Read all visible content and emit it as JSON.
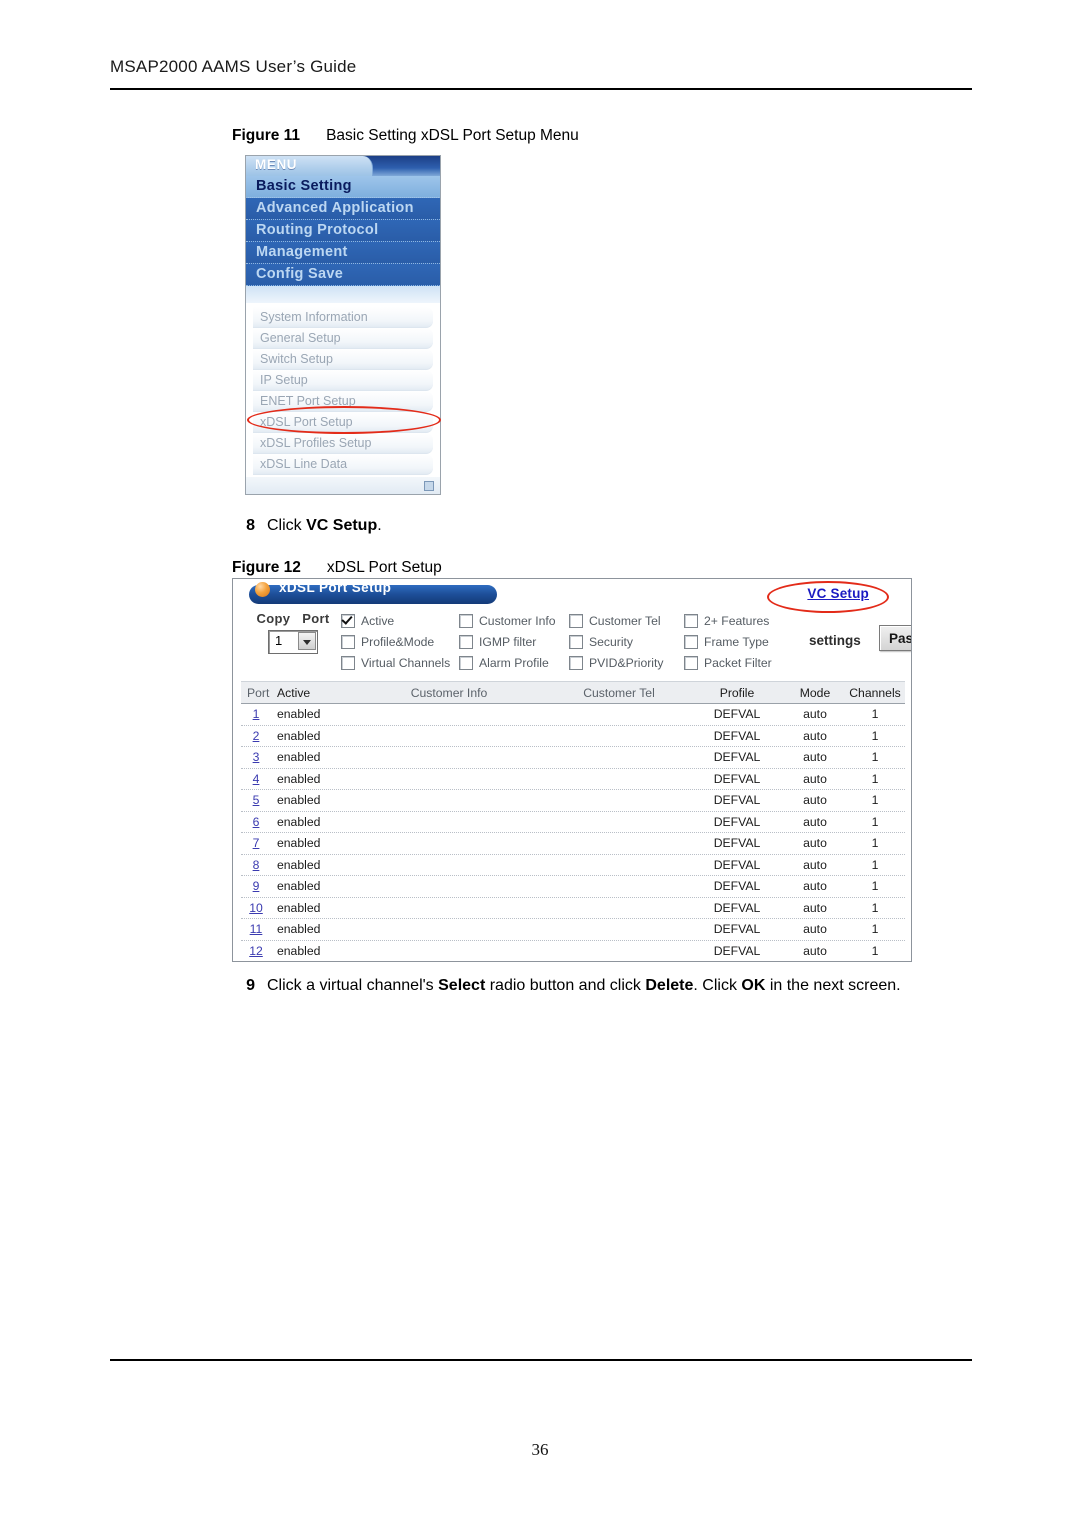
{
  "page": {
    "header_title": "MSAP2000 AAMS User’s Guide",
    "page_number": "36"
  },
  "figure11": {
    "label": "Figure 11",
    "title": "Basic Setting xDSL Port Setup Menu",
    "menu": {
      "tab_label": "MENU",
      "main_items": [
        {
          "label": "Basic Setting",
          "selected": true
        },
        {
          "label": "Advanced Application",
          "selected": false
        },
        {
          "label": "Routing Protocol",
          "selected": false
        },
        {
          "label": "Management",
          "selected": false
        },
        {
          "label": "Config Save",
          "selected": false
        }
      ],
      "sub_items": [
        {
          "label": "System Information",
          "highlighted": false
        },
        {
          "label": "General Setup",
          "highlighted": false
        },
        {
          "label": "Switch Setup",
          "highlighted": false
        },
        {
          "label": "IP Setup",
          "highlighted": false
        },
        {
          "label": "ENET Port Setup",
          "highlighted": false
        },
        {
          "label": "xDSL Port Setup",
          "highlighted": true
        },
        {
          "label": "xDSL Profiles Setup",
          "highlighted": false
        },
        {
          "label": "xDSL Line Data",
          "highlighted": false
        }
      ],
      "highlight_color": "#e32b19"
    }
  },
  "step8": {
    "number": "8",
    "text_before": "Click ",
    "bold": "VC Setup",
    "text_after": "."
  },
  "figure12": {
    "label": "Figure 12",
    "title": "xDSL Port Setup",
    "screen": {
      "panel_title": "xDSL Port Setup",
      "vc_setup_link": "VC Setup",
      "copy_label": "Copy",
      "port_label": "Port",
      "port_select_value": "1",
      "settings_label": "settings",
      "paste_button": "Paste",
      "checkboxes": [
        {
          "label": "Active",
          "checked": true
        },
        {
          "label": "Customer Info",
          "checked": false
        },
        {
          "label": "Customer Tel",
          "checked": false
        },
        {
          "label": "2+ Features",
          "checked": false
        },
        {
          "label": "Profile&Mode",
          "checked": false
        },
        {
          "label": "IGMP filter",
          "checked": false
        },
        {
          "label": "Security",
          "checked": false
        },
        {
          "label": "Frame Type",
          "checked": false
        },
        {
          "label": "Virtual Channels",
          "checked": false
        },
        {
          "label": "Alarm Profile",
          "checked": false
        },
        {
          "label": "PVID&Priority",
          "checked": false
        },
        {
          "label": "Packet Filter",
          "checked": false
        }
      ],
      "table": {
        "columns": [
          "Port",
          "Active",
          "Customer Info",
          "Customer Tel",
          "Profile",
          "Mode",
          "Channels"
        ],
        "rows": [
          {
            "port": "1",
            "active": "enabled",
            "customer_info": "",
            "customer_tel": "",
            "profile": "DEFVAL",
            "mode": "auto",
            "channels": "1"
          },
          {
            "port": "2",
            "active": "enabled",
            "customer_info": "",
            "customer_tel": "",
            "profile": "DEFVAL",
            "mode": "auto",
            "channels": "1"
          },
          {
            "port": "3",
            "active": "enabled",
            "customer_info": "",
            "customer_tel": "",
            "profile": "DEFVAL",
            "mode": "auto",
            "channels": "1"
          },
          {
            "port": "4",
            "active": "enabled",
            "customer_info": "",
            "customer_tel": "",
            "profile": "DEFVAL",
            "mode": "auto",
            "channels": "1"
          },
          {
            "port": "5",
            "active": "enabled",
            "customer_info": "",
            "customer_tel": "",
            "profile": "DEFVAL",
            "mode": "auto",
            "channels": "1"
          },
          {
            "port": "6",
            "active": "enabled",
            "customer_info": "",
            "customer_tel": "",
            "profile": "DEFVAL",
            "mode": "auto",
            "channels": "1"
          },
          {
            "port": "7",
            "active": "enabled",
            "customer_info": "",
            "customer_tel": "",
            "profile": "DEFVAL",
            "mode": "auto",
            "channels": "1"
          },
          {
            "port": "8",
            "active": "enabled",
            "customer_info": "",
            "customer_tel": "",
            "profile": "DEFVAL",
            "mode": "auto",
            "channels": "1"
          },
          {
            "port": "9",
            "active": "enabled",
            "customer_info": "",
            "customer_tel": "",
            "profile": "DEFVAL",
            "mode": "auto",
            "channels": "1"
          },
          {
            "port": "10",
            "active": "enabled",
            "customer_info": "",
            "customer_tel": "",
            "profile": "DEFVAL",
            "mode": "auto",
            "channels": "1"
          },
          {
            "port": "11",
            "active": "enabled",
            "customer_info": "",
            "customer_tel": "",
            "profile": "DEFVAL",
            "mode": "auto",
            "channels": "1"
          },
          {
            "port": "12",
            "active": "enabled",
            "customer_info": "",
            "customer_tel": "",
            "profile": "DEFVAL",
            "mode": "auto",
            "channels": "1"
          }
        ]
      }
    }
  },
  "step9": {
    "number": "9",
    "part1": "Click a virtual channel's ",
    "bold1": "Select",
    "part2": " radio button and click ",
    "bold2": "Delete",
    "part3": ". Click ",
    "bold3": "OK",
    "part4": " in the next screen."
  }
}
